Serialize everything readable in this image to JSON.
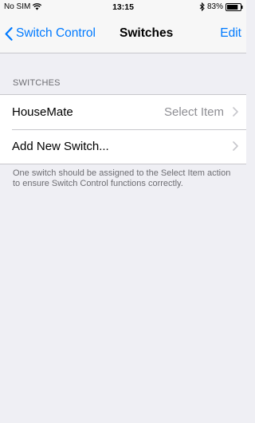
{
  "status_bar": {
    "carrier": "No SIM",
    "time": "13:15",
    "battery_percent": "83%",
    "battery_level": 0.83
  },
  "nav": {
    "back_label": "Switch Control",
    "title": "Switches",
    "edit_label": "Edit"
  },
  "section": {
    "header": "SWITCHES",
    "rows": [
      {
        "label": "HouseMate",
        "detail": "Select Item"
      },
      {
        "label": "Add New Switch...",
        "detail": ""
      }
    ],
    "footer": "One switch should be assigned to the Select Item action to ensure Switch Control functions correctly."
  },
  "colors": {
    "accent": "#007aff",
    "background": "#efeff4",
    "secondary_text": "#6d6d72",
    "detail_text": "#8e8e93",
    "separator": "#c8c7cc"
  }
}
